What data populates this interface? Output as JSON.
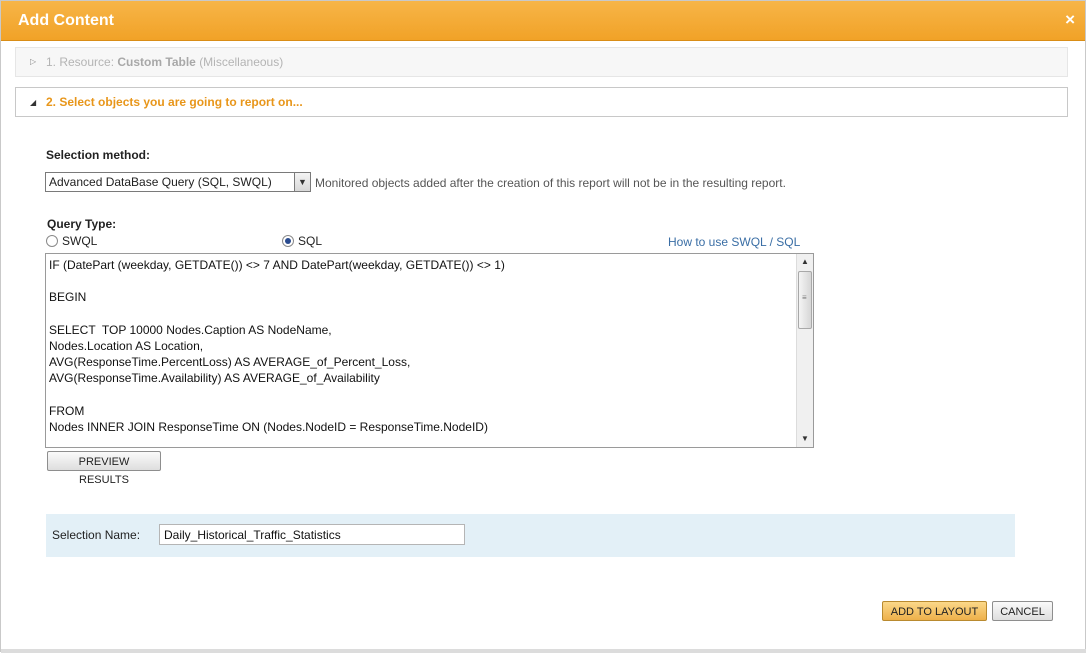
{
  "dialog": {
    "title": "Add Content",
    "close_glyph": "×"
  },
  "steps": {
    "step1": {
      "prefix": "1. Resource:",
      "name": "Custom Table",
      "suffix": "(Miscellaneous)",
      "collapsed_icon": "triangle-right-icon"
    },
    "step2": {
      "label": "2. Select objects you are going to report on...",
      "expanded_icon": "triangle-down-icon"
    }
  },
  "selection": {
    "method_label": "Selection method:",
    "method_value": "Advanced DataBase Query (SQL, SWQL)",
    "note": "Monitored objects added after the creation of this report will not be in the resulting report."
  },
  "query": {
    "type_label": "Query Type:",
    "options": [
      {
        "label": "SWQL",
        "selected": false
      },
      {
        "label": "SQL",
        "selected": true
      }
    ],
    "help_link": "How to use SWQL / SQL",
    "text": "IF (DatePart (weekday, GETDATE()) <> 7 AND DatePart(weekday, GETDATE()) <> 1)\n\nBEGIN\n\nSELECT  TOP 10000 Nodes.Caption AS NodeName,\nNodes.Location AS Location,\nAVG(ResponseTime.PercentLoss) AS AVERAGE_of_Percent_Loss,\nAVG(ResponseTime.Availability) AS AVERAGE_of_Availability\n\nFROM\nNodes INNER JOIN ResponseTime ON (Nodes.NodeID = ResponseTime.NodeID)",
    "preview_button": "PREVIEW RESULTS"
  },
  "selection_name": {
    "label": "Selection Name:",
    "value": "Daily_Historical_Traffic_Statistics"
  },
  "footer": {
    "add_button": "ADD TO LAYOUT",
    "cancel_button": "CANCEL"
  },
  "colors": {
    "titlebar": "#f1a227",
    "step2_text": "#e8961a",
    "link": "#3a6ea5",
    "namebar_bg": "#e3f0f7"
  }
}
